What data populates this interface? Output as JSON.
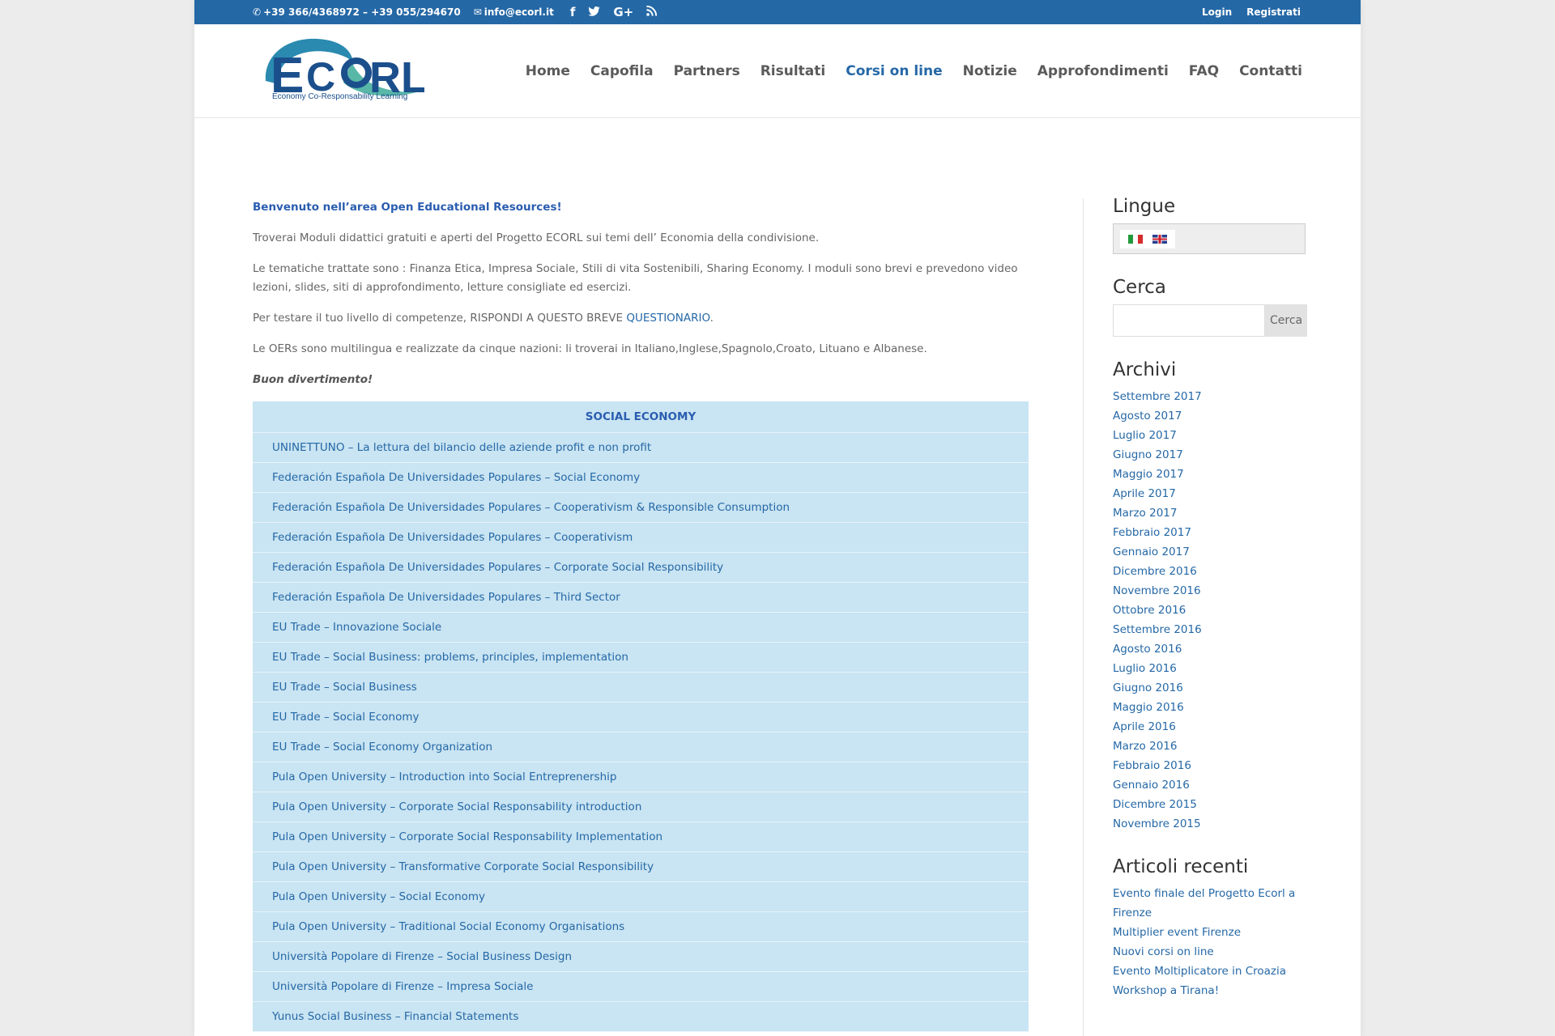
{
  "topbar": {
    "phone": "+39 366/4368972 – +39 055/294670",
    "email": "info@ecorl.it",
    "login": "Login",
    "register": "Registrati"
  },
  "logo": {
    "text": "ECORL",
    "tagline": "Economy Co-Responsability Learning"
  },
  "nav": [
    {
      "label": "Home"
    },
    {
      "label": "Capofila"
    },
    {
      "label": "Partners"
    },
    {
      "label": "Risultati"
    },
    {
      "label": "Corsi on line"
    },
    {
      "label": "Notizie"
    },
    {
      "label": "Approfondimenti"
    },
    {
      "label": "FAQ"
    },
    {
      "label": "Contatti"
    }
  ],
  "content": {
    "welcome": "Benvenuto nell’area Open Educational Resources!",
    "p1": "Troverai Moduli didattici gratuiti e aperti del Progetto ECORL sui temi dell’ Economia della condivisione.",
    "p2": "Le tematiche trattate sono : Finanza Etica, Impresa Sociale, Stili di vita Sostenibili, Sharing Economy. I moduli sono brevi e prevedono video lezioni, slides, siti di approfondimento, letture consigliate ed esercizi.",
    "p3_pre": "Per testare il tuo livello di competenze, RISPONDI A QUESTO BREVE ",
    "p3_link": "QUESTIONARIO",
    "p3_post": ".",
    "p4": "Le OERs sono multilingua e realizzate da cinque nazioni: li troverai in Italiano,Inglese,Spagnolo,Croato, Lituano e Albanese.",
    "p5": "Buon divertimento!",
    "table_header": "SOCIAL ECONOMY",
    "courses": [
      "UNINETTUNO – La lettura del bilancio delle aziende profit e non profit",
      "Federación Española De Universidades Populares – Social Economy",
      "Federación Española De Universidades Populares – Cooperativism & Responsible Consumption",
      "Federación Española De Universidades Populares – Cooperativism",
      "Federación Española De Universidades Populares – Corporate Social Responsibility",
      "Federación Española De Universidades Populares – Third Sector",
      "EU Trade – Innovazione Sociale",
      "EU Trade – Social Business: problems, principles, implementation",
      "EU Trade – Social Business",
      "EU Trade – Social Economy",
      "EU Trade – Social Economy Organization",
      "Pula Open University – Introduction into Social Entreprenership",
      "Pula Open University – Corporate Social Responsability introduction",
      "Pula Open University – Corporate Social Responsability Implementation",
      "Pula Open University – Transformative Corporate Social Responsibility",
      "Pula Open University – Social Economy",
      "Pula Open University – Traditional Social Economy Organisations",
      "Università Popolare di Firenze – Social Business Design",
      "Università Popolare di Firenze – Impresa Sociale",
      "Yunus Social Business – Financial Statements"
    ]
  },
  "sidebar": {
    "lang_title": "Lingue",
    "search_title": "Cerca",
    "search_button": "Cerca",
    "archive_title": "Archivi",
    "archives": [
      "Settembre 2017",
      "Agosto 2017",
      "Luglio 2017",
      "Giugno 2017",
      "Maggio 2017",
      "Aprile 2017",
      "Marzo 2017",
      "Febbraio 2017",
      "Gennaio 2017",
      "Dicembre 2016",
      "Novembre 2016",
      "Ottobre 2016",
      "Settembre 2016",
      "Agosto 2016",
      "Luglio 2016",
      "Giugno 2016",
      "Maggio 2016",
      "Aprile 2016",
      "Marzo 2016",
      "Febbraio 2016",
      "Gennaio 2016",
      "Dicembre 2015",
      "Novembre 2015"
    ],
    "recent_title": "Articoli recenti",
    "recent": [
      "Evento finale del Progetto Ecorl a Firenze",
      "Multiplier event Firenze",
      "Nuovi corsi on line",
      "Evento Moltiplicatore in Croazia",
      "Workshop a Tirana!"
    ]
  },
  "colors": {
    "brand": "#2568a6",
    "table_bg": "#c9e4f2"
  }
}
